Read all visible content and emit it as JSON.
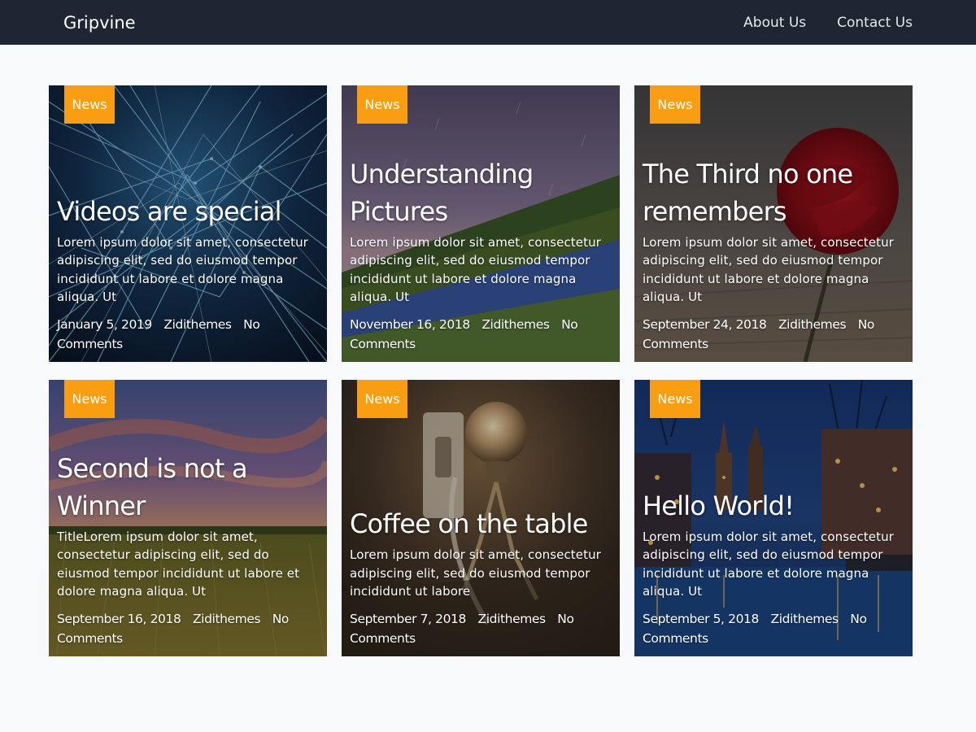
{
  "site": {
    "brand": "Gripvine"
  },
  "nav": {
    "items": [
      {
        "label": "About Us"
      },
      {
        "label": "Contact Us"
      }
    ]
  },
  "posts": [
    {
      "category": "News",
      "title": "Videos are special",
      "excerpt": "Lorem ipsum dolor sit amet, consectetur adipiscing elit, sed do eiusmod tempor incididunt ut labore et dolore magna aliqua. Ut",
      "date": "January 5, 2019",
      "author": "Zidithemes",
      "comments": "No Comments"
    },
    {
      "category": "News",
      "title": "Understanding Pictures",
      "excerpt": "Lorem ipsum dolor sit amet, consectetur adipiscing elit, sed do eiusmod tempor incididunt ut labore et dolore magna aliqua. Ut",
      "date": "November 16, 2018",
      "author": "Zidithemes",
      "comments": "No Comments"
    },
    {
      "category": "News",
      "title": "The Third no one remembers",
      "excerpt": "Lorem ipsum dolor sit amet, consectetur adipiscing elit, sed do eiusmod tempor incididunt ut labore et dolore magna aliqua. Ut",
      "date": "September 24, 2018",
      "author": "Zidithemes",
      "comments": "No Comments"
    },
    {
      "category": "News",
      "title": "Second is not a Winner",
      "excerpt": "TitleLorem ipsum dolor sit amet, consectetur adipiscing elit, sed do eiusmod tempor incididunt ut labore et dolore magna aliqua. Ut",
      "date": "September 16, 2018",
      "author": "Zidithemes",
      "comments": "No Comments"
    },
    {
      "category": "News",
      "title": "Coffee on the table",
      "excerpt": "Lorem ipsum dolor sit amet, consectetur adipiscing elit, sed do eiusmod tempor incididunt ut labore",
      "date": "September 7, 2018",
      "author": "Zidithemes",
      "comments": "No Comments"
    },
    {
      "category": "News",
      "title": "Hello World!",
      "excerpt": "Lorem ipsum dolor sit amet, consectetur adipiscing elit, sed do eiusmod tempor incididunt ut labore et dolore magna aliqua. Ut",
      "date": "September 5, 2018",
      "author": "Zidithemes",
      "comments": "No Comments"
    }
  ],
  "colors": {
    "navbar": "#1d2632",
    "page_background": "#f8f9fa",
    "category_badge": "#f99d13",
    "text": "#ffffff"
  }
}
